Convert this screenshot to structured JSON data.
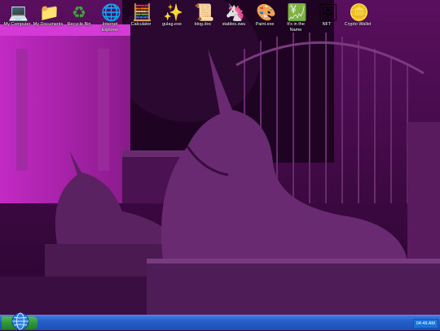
{
  "desktop_icons": [
    {
      "label": "My Computer",
      "icon": "computer-icon"
    },
    {
      "label": "My Documents",
      "icon": "folder-icon"
    },
    {
      "label": "Recycle Bin",
      "icon": "recycle-bin-icon"
    },
    {
      "label": "Internet Explorer",
      "icon": "globe-icon"
    },
    {
      "label": "Calculator",
      "icon": "calculator-icon"
    },
    {
      "label": "gulag.exe",
      "icon": "sparkles-icon"
    },
    {
      "label": "blog.doc",
      "icon": "scroll-icon"
    },
    {
      "label": "stables.swu",
      "icon": "unicorn-icon"
    },
    {
      "label": "Paint.exe",
      "icon": "palette-icon"
    },
    {
      "label": "It's in the Name",
      "icon": "yen-chart-icon"
    },
    {
      "label": "NFT",
      "icon": "framed-picture-icon"
    },
    {
      "label": "Crypto Wallet",
      "icon": "coin-icon"
    }
  ],
  "taskbar": {
    "clock": "04:49 AM",
    "start_icon": "globe-icon"
  },
  "colors": {
    "wallpaper_tint": "#7a1a7e",
    "taskbar": "#245ec9",
    "start_button": "#2f9a35"
  }
}
